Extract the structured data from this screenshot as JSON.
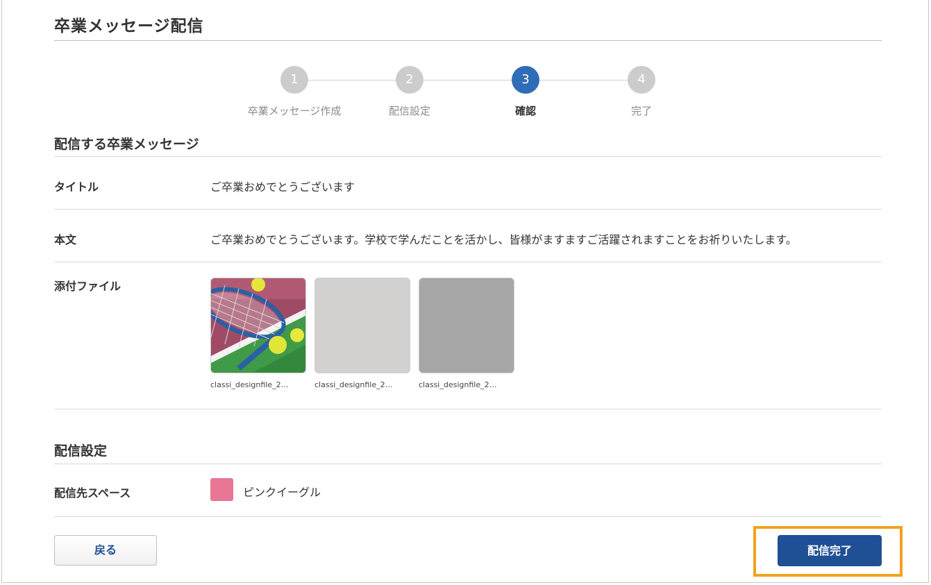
{
  "page": {
    "title": "卒業メッセージ配信"
  },
  "stepper": {
    "steps": [
      {
        "number": "1",
        "label": "卒業メッセージ作成",
        "active": false
      },
      {
        "number": "2",
        "label": "配信設定",
        "active": false
      },
      {
        "number": "3",
        "label": "確認",
        "active": true
      },
      {
        "number": "4",
        "label": "完了",
        "active": false
      }
    ]
  },
  "message_section": {
    "heading": "配信する卒業メッセージ",
    "title_label": "タイトル",
    "title_value": "ご卒業おめでとうございます",
    "body_label": "本文",
    "body_value": "ご卒業おめでとうございます。学校で学んだことを活かし、皆様がますますご活躍されますことをお祈りいたします。",
    "attachments_label": "添付ファイル",
    "attachments": [
      {
        "name": "classi_designfile_2…",
        "kind": "tennis-photo"
      },
      {
        "name": "classi_designfile_2…",
        "kind": "placeholder-light",
        "color": "#d2d1d0"
      },
      {
        "name": "classi_designfile_2…",
        "kind": "placeholder-dark",
        "color": "#a6a6a6"
      }
    ]
  },
  "delivery_section": {
    "heading": "配信設定",
    "space_label": "配信先スペース",
    "space_name": "ピンクイーグル",
    "space_color": "#e87694"
  },
  "actions": {
    "back_label": "戻る",
    "submit_label": "配信完了"
  }
}
